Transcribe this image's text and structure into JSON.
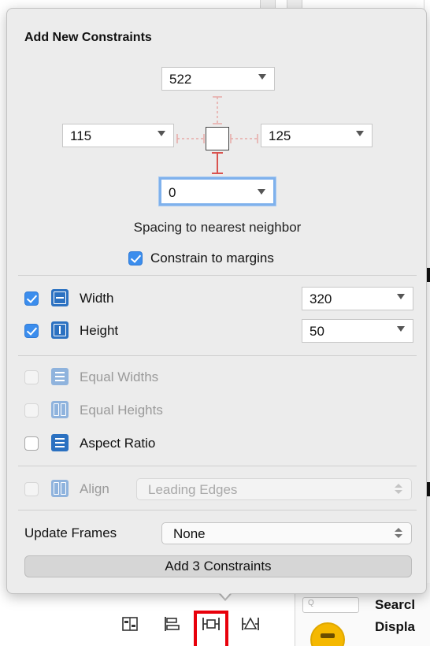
{
  "popover": {
    "title": "Add New Constraints",
    "spacing": {
      "top": "522",
      "left": "115",
      "right": "125",
      "bottom": "0",
      "caption": "Spacing to nearest neighbor"
    },
    "constrain_to_margins": {
      "label": "Constrain to margins",
      "checked": true
    },
    "width": {
      "label": "Width",
      "value": "320",
      "checked": true
    },
    "height": {
      "label": "Height",
      "value": "50",
      "checked": true
    },
    "equal_widths": {
      "label": "Equal Widths",
      "checked": false,
      "enabled": false
    },
    "equal_heights": {
      "label": "Equal Heights",
      "checked": false,
      "enabled": false
    },
    "aspect_ratio": {
      "label": "Aspect Ratio",
      "checked": false,
      "enabled": true
    },
    "align": {
      "label": "Align",
      "value": "Leading Edges",
      "checked": false,
      "enabled": false
    },
    "update_frames": {
      "label": "Update Frames",
      "value": "None"
    },
    "add_button": "Add 3 Constraints"
  },
  "background": {
    "search_placeholder": "Q",
    "label_line1": "Searcl",
    "label_line2": "Displa"
  },
  "toolbar": {
    "icons": [
      "stack-icon",
      "align-icon",
      "pin-icon",
      "resolve-issues-icon"
    ],
    "highlighted": "pin-icon"
  },
  "colors": {
    "accent": "#3b8ded",
    "constraint_icon": "#2b71c1",
    "strut_red": "#d9534f",
    "highlight_red": "#e8000b",
    "focus_ring": "#7fb1ec"
  }
}
